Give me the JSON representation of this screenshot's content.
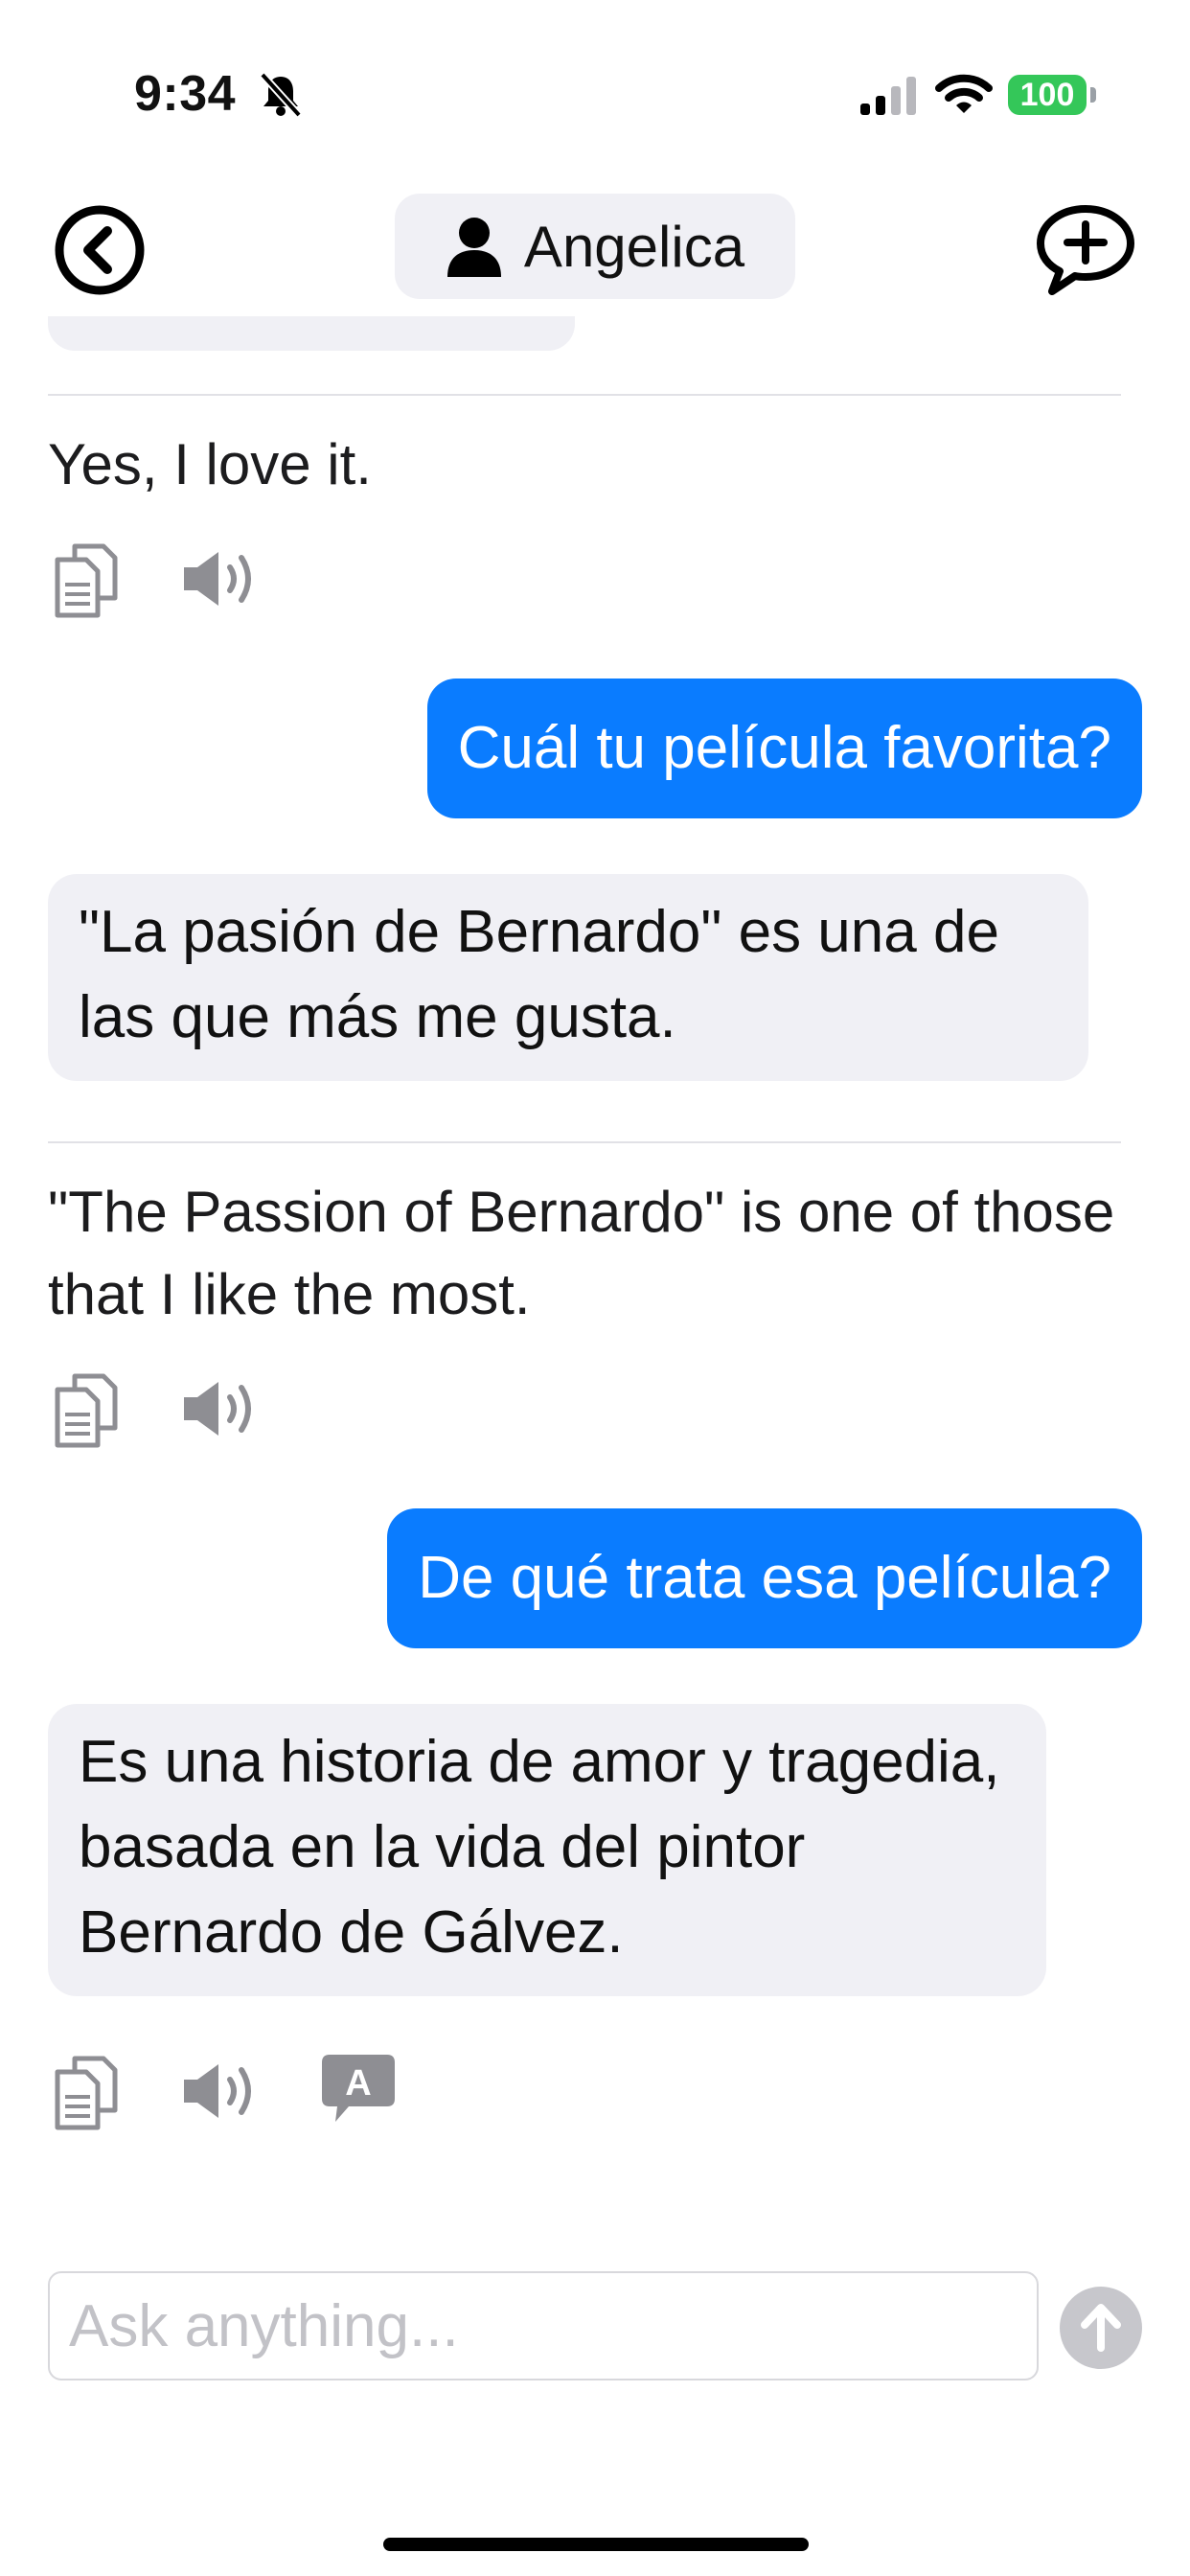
{
  "status_bar": {
    "time": "9:34",
    "battery": "100",
    "icons": [
      "bell-slash-icon",
      "cellular-signal-icon",
      "wifi-icon",
      "battery-icon"
    ]
  },
  "header": {
    "contact_name": "Angelica",
    "icons": [
      "back-circle-icon",
      "person-icon",
      "new-chat-bubble-plus-icon"
    ]
  },
  "messages": [
    {
      "role": "translation",
      "text": "Yes, I love it."
    },
    {
      "role": "user",
      "text": "Cuál tu película favorita?"
    },
    {
      "role": "assistant",
      "text": "\"La pasión de Bernardo\" es una de las que más me gusta."
    },
    {
      "role": "translation",
      "text": "\"The Passion of Bernardo\" is one of those that I like the most."
    },
    {
      "role": "user",
      "text": "De qué trata esa película?"
    },
    {
      "role": "assistant",
      "text": "Es una historia de amor y tragedia, basada en la vida del pintor Bernardo de Gálvez."
    }
  ],
  "actions": {
    "translate_badge": "A",
    "icons": [
      "copy-icon",
      "speaker-icon",
      "translate-icon"
    ]
  },
  "input": {
    "placeholder": "Ask anything...",
    "value": ""
  },
  "colors": {
    "user_bubble": "#0a7cff",
    "assistant_bubble": "#f0f0f5",
    "send_disabled": "#c7c7cc",
    "battery": "#34c759"
  }
}
